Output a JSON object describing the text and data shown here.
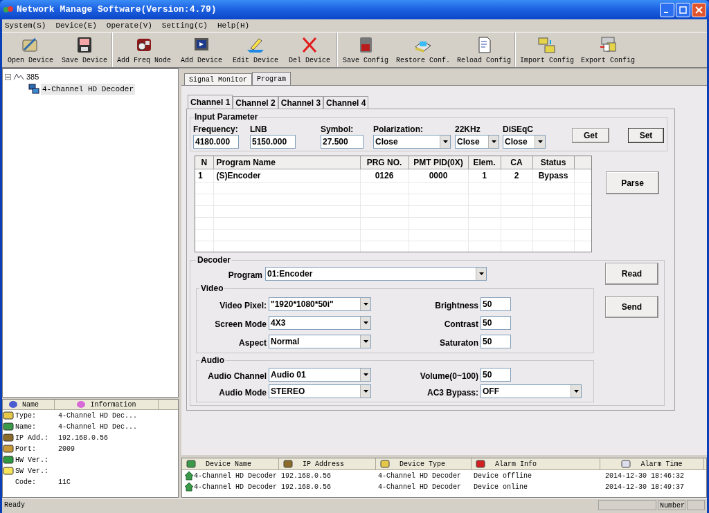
{
  "window": {
    "title": "Network Manage Software(Version:4.79)"
  },
  "menu": [
    "System(S)",
    "Device(E)",
    "Operate(V)",
    "Setting(C)",
    "Help(H)"
  ],
  "toolbar": [
    [
      {
        "label": "Open Device"
      },
      {
        "label": "Save Device"
      }
    ],
    [
      {
        "label": "Add Freq Node"
      },
      {
        "label": "Add Device"
      },
      {
        "label": "Edit Device"
      },
      {
        "label": "Del Device"
      }
    ],
    [
      {
        "label": "Save Config"
      },
      {
        "label": "Restore Conf."
      },
      {
        "label": "Reload Config"
      }
    ],
    [
      {
        "label": "Import Config"
      },
      {
        "label": "Export Config"
      }
    ]
  ],
  "tree": {
    "label": "385",
    "expanded": true,
    "children": [
      {
        "label": "4-Channel HD Decoder",
        "selected": true
      }
    ]
  },
  "info": {
    "columns": [
      "Name",
      "Information"
    ],
    "rows": [
      {
        "label": "Type:",
        "value": "4-Channel HD Dec..."
      },
      {
        "label": "Name:",
        "value": "4-Channel HD Dec..."
      },
      {
        "label": "IP Add.:",
        "value": "192.168.0.56"
      },
      {
        "label": "Port:",
        "value": "2009"
      },
      {
        "label": "HW Ver.:"
      },
      {
        "label": "SW Ver.:"
      },
      {
        "label": "Code:",
        "value": "11C"
      }
    ]
  },
  "tabs": [
    {
      "label": "Signal Monitor",
      "selected": false
    },
    {
      "label": "Program",
      "selected": true
    }
  ],
  "channel_tabs": [
    {
      "label": "Channel 1",
      "selected": true
    },
    {
      "label": "Channel 2",
      "selected": false
    },
    {
      "label": "Channel 3",
      "selected": false
    },
    {
      "label": "Channel 4",
      "selected": false
    }
  ],
  "input_parameter": {
    "title": "Input Parameter",
    "fields": [
      {
        "label": "Frequency:",
        "value": "4180.000",
        "kind": "text"
      },
      {
        "label": "LNB",
        "value": "5150.000",
        "kind": "text"
      },
      {
        "label": "Symbol:",
        "value": "27.500",
        "kind": "text"
      },
      {
        "label": "Polarization:",
        "value": "Close",
        "kind": "select"
      },
      {
        "label": "22KHz",
        "value": "Close",
        "kind": "select"
      },
      {
        "label": "DiSEqC",
        "value": "Close",
        "kind": "select"
      }
    ],
    "buttons": [
      "Get",
      "Set"
    ]
  },
  "program_table": {
    "columns": [
      "N",
      "Program Name",
      "PRG NO.",
      "PMT PID(0X)",
      "Elem.",
      "CA",
      "Status"
    ],
    "rows": [
      [
        "1",
        "(S)Encoder",
        "0126",
        "0000",
        "1",
        "2",
        "Bypass"
      ]
    ]
  },
  "parse_button": "Parse",
  "decoder": {
    "title": "Decoder",
    "program": {
      "label": "Program",
      "value": "01:Encoder"
    },
    "video": {
      "title": "Video",
      "rows": [
        {
          "label": "Video Pixel:",
          "value": "\"1920*1080*50i\"",
          "right_label": "Brightness",
          "right_value": "50"
        },
        {
          "label": "Screen Mode",
          "value": "4X3",
          "right_label": "Contrast",
          "right_value": "50"
        },
        {
          "label": "Aspect",
          "value": "Normal",
          "right_label": "Saturaton",
          "right_value": "50"
        }
      ]
    },
    "audio": {
      "title": "Audio",
      "rows": [
        {
          "label": "Audio Channel",
          "value": "Audio 01",
          "right_label": "Volume(0~100)",
          "right_value": "50",
          "kind": "text"
        },
        {
          "label": "Audio Mode",
          "value": "STEREO",
          "right_label": "AC3 Bypass:",
          "right_value": "OFF",
          "kind": "select"
        }
      ]
    },
    "buttons": [
      "Read",
      "Send"
    ]
  },
  "alarms": {
    "columns": [
      "Device Name",
      "IP Address",
      "Device Type",
      "Alarm Info",
      "Alarm Time"
    ],
    "rows": [
      [
        "4-Channel HD Decoder",
        "192.168.0.56",
        "4-Channel HD Decoder",
        "Device offline",
        "2014-12-30 18:46:32"
      ],
      [
        "4-Channel HD Decoder",
        "192.168.0.56",
        "4-Channel HD Decoder",
        "Device online",
        "2014-12-30 18:49:37"
      ]
    ]
  },
  "status_bar": {
    "text": "Ready",
    "panel": "Number"
  }
}
